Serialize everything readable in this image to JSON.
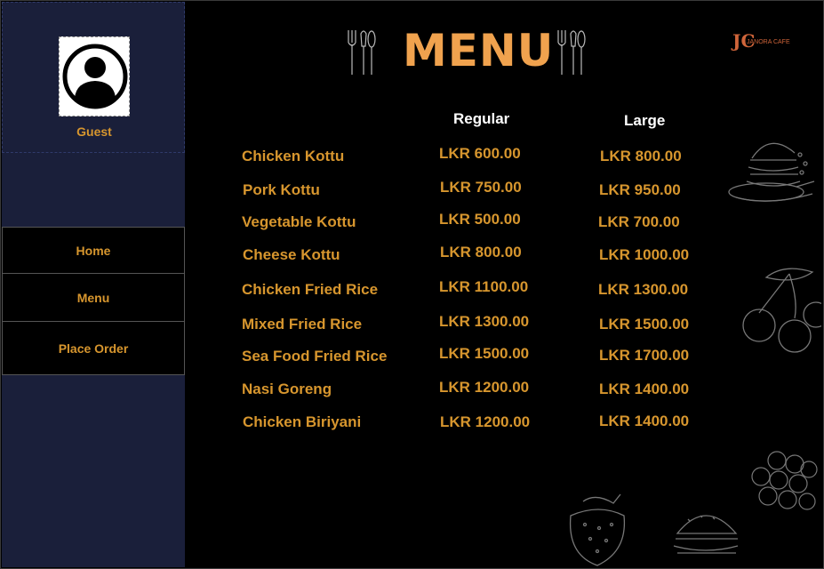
{
  "sidebar": {
    "user_label": "Guest",
    "nav": [
      {
        "label": "Home"
      },
      {
        "label": "Menu"
      },
      {
        "label": "Place Order"
      }
    ]
  },
  "header": {
    "title": "MENU",
    "logo_initials": "JC",
    "logo_name": "JANORA CAFE"
  },
  "menu": {
    "columns": [
      "Regular",
      "Large"
    ],
    "items": [
      {
        "name": "Chicken Kottu",
        "regular": "LKR 600.00",
        "large": "LKR 800.00"
      },
      {
        "name": "Pork Kottu",
        "regular": "LKR 750.00",
        "large": "LKR 950.00"
      },
      {
        "name": "Vegetable Kottu",
        "regular": "LKR 500.00",
        "large": "LKR 700.00"
      },
      {
        "name": "Cheese Kottu",
        "regular": "LKR 800.00",
        "large": "LKR 1000.00"
      },
      {
        "name": "Chicken Fried Rice",
        "regular": "LKR 1100.00",
        "large": "LKR 1300.00"
      },
      {
        "name": "Mixed Fried Rice",
        "regular": "LKR 1300.00",
        "large": "LKR 1500.00"
      },
      {
        "name": "Sea Food Fried Rice",
        "regular": "LKR 1500.00",
        "large": "LKR 1700.00"
      },
      {
        "name": "Nasi Goreng",
        "regular": "LKR 1200.00",
        "large": "LKR 1400.00"
      },
      {
        "name": "Chicken Biriyani",
        "regular": "LKR 1200.00",
        "large": "LKR 1400.00"
      }
    ]
  },
  "colors": {
    "accent": "#d7962e",
    "title": "#f0a24e",
    "sidebar_bg": "#1a1f3a",
    "main_bg": "#000000"
  }
}
